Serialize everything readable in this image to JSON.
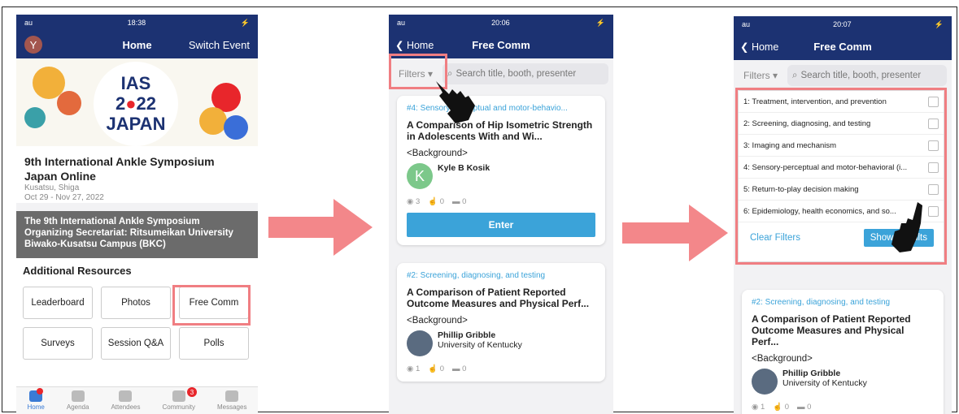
{
  "screen1": {
    "status": {
      "carrier": "au",
      "time": "18:38",
      "battery": "⚡"
    },
    "nav": {
      "avatar": "Y",
      "title": "Home",
      "switch": "Switch Event"
    },
    "banner": {
      "line1": "IAS",
      "line2a": "2",
      "line2dot": "●",
      "line2b": "22",
      "line3": "JAPAN"
    },
    "event": {
      "title": "9th International Ankle Symposium Japan Online",
      "location": "Kusatsu, Shiga",
      "dates": "Oct 29 - Nov 27, 2022"
    },
    "organizer": "The 9th International Ankle Symposium Organizing Secretariat: Ritsumeikan University Biwako-Kusatsu Campus (BKC)",
    "resources": {
      "heading": "Additional Resources",
      "items": [
        "Leaderboard",
        "Photos",
        "Free Comm",
        "Surveys",
        "Session Q&A",
        "Polls"
      ]
    },
    "tabs": [
      "Home",
      "Agenda",
      "Attendees",
      "Community",
      "Messages"
    ],
    "community_badge": "3"
  },
  "screen2": {
    "status": {
      "carrier": "au",
      "time": "20:06",
      "battery": "⚡"
    },
    "nav": {
      "back": "Home",
      "title": "Free Comm"
    },
    "filters": "Filters",
    "search_placeholder": "Search title, booth, presenter",
    "cards": [
      {
        "tag": "#4: Sensory-perceptual and motor-behavio...",
        "title": "A Comparison of Hip Isometric Strength in Adolescents With and Wi...",
        "bg": "<Background>",
        "presenter": "Kyle B Kosik",
        "initial": "K",
        "views": "3",
        "likes": "0",
        "comments": "0",
        "enter": "Enter"
      },
      {
        "tag": "#2: Screening, diagnosing, and testing",
        "title": "A Comparison of Patient Reported Outcome Measures and Physical Perf...",
        "bg": "<Background>",
        "presenter": "Phillip Gribble",
        "org": "University of Kentucky",
        "views": "1",
        "likes": "0",
        "comments": "0"
      }
    ]
  },
  "screen3": {
    "status": {
      "carrier": "au",
      "time": "20:07",
      "battery": "⚡"
    },
    "nav": {
      "back": "Home",
      "title": "Free Comm"
    },
    "filters": "Filters",
    "search_placeholder": "Search title, booth, presenter",
    "options": [
      "1: Treatment, intervention, and prevention",
      "2: Screening, diagnosing, and testing",
      "3: Imaging and mechanism",
      "4: Sensory-perceptual and motor-behavioral (i...",
      "5: Return-to-play decision making",
      "6: Epidemiology, health economics, and so..."
    ],
    "clear": "Clear Filters",
    "show": "Show Results",
    "card": {
      "tag": "#2: Screening, diagnosing, and testing",
      "title": "A Comparison of Patient Reported Outcome Measures and Physical Perf...",
      "bg": "<Background>",
      "presenter": "Phillip Gribble",
      "org": "University of Kentucky",
      "views": "1",
      "likes": "0",
      "comments": "0"
    }
  },
  "colors": {
    "navy": "#1c3272",
    "accent": "#3ba3d9",
    "highlight": "#f07e82",
    "arrow": "#f3878a"
  }
}
